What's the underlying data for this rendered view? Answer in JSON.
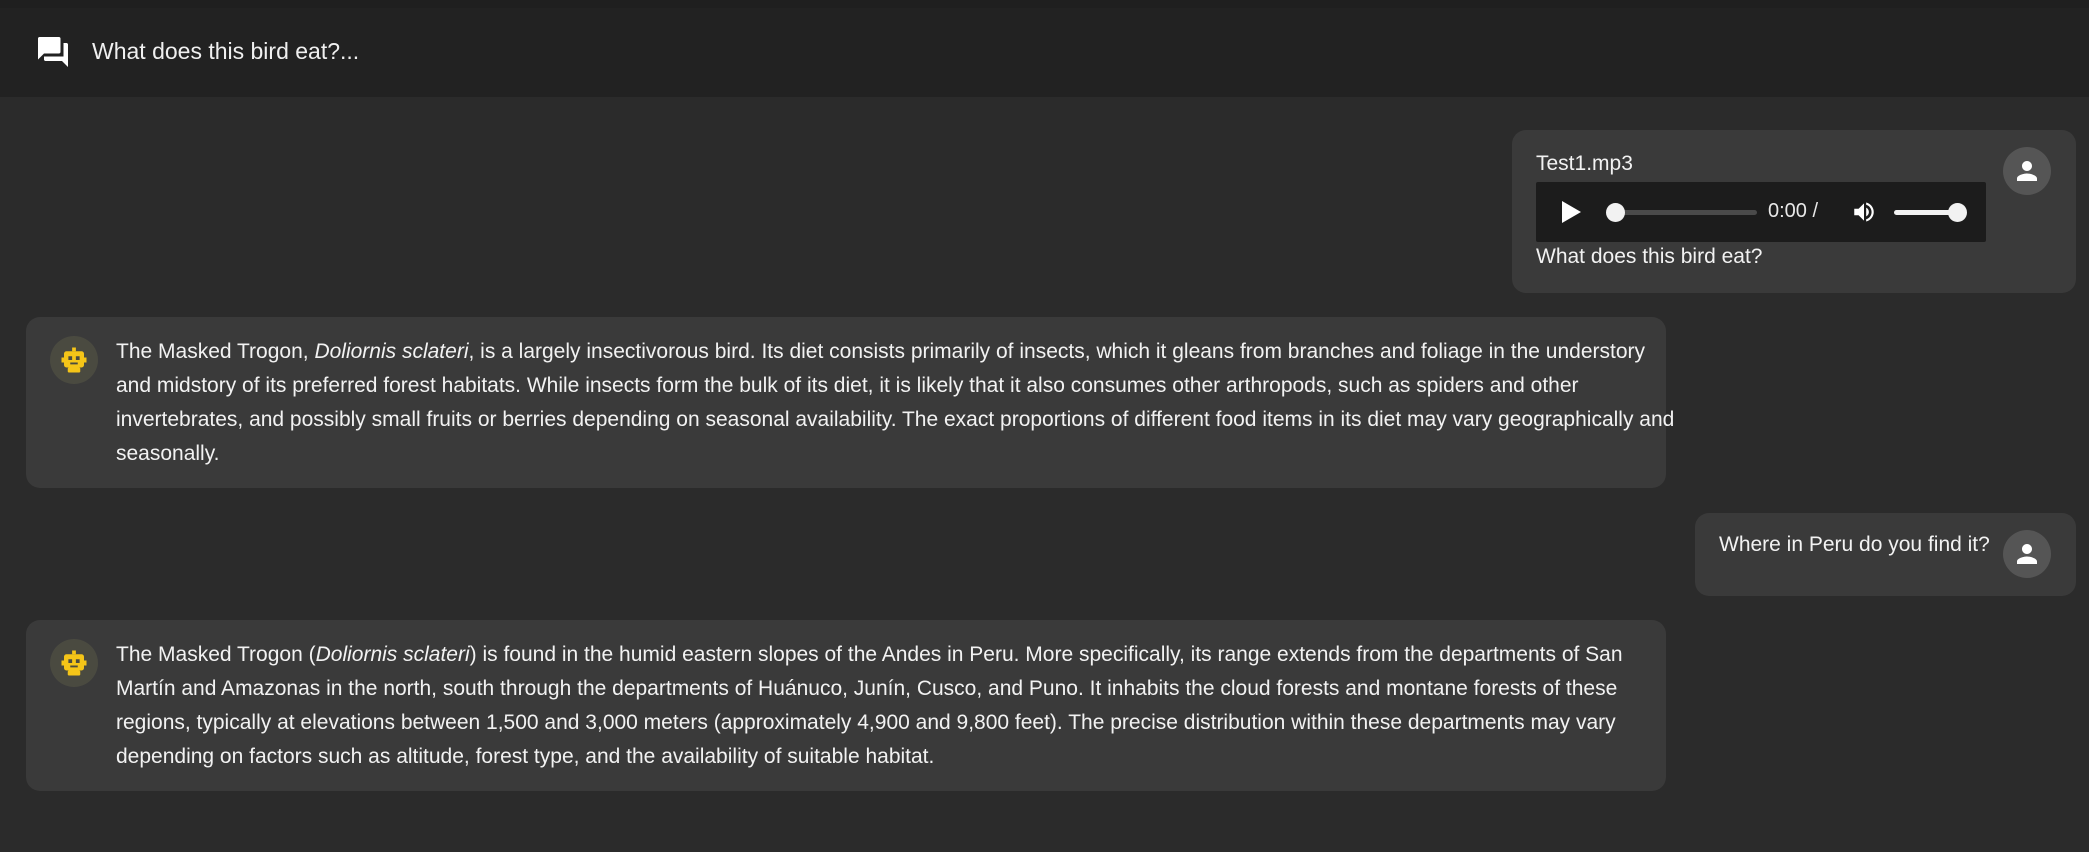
{
  "header": {
    "title": "What does this bird eat?...",
    "icon": "chat-bubbles-icon"
  },
  "messages": [
    {
      "role": "user",
      "attachment": {
        "filename": "Test1.mp3",
        "time": "0:00 /",
        "progress": 0.0,
        "volume": 1.0
      },
      "text": "What does this bird eat?"
    },
    {
      "role": "assistant",
      "parts": [
        "The Masked Trogon, ",
        "Doliornis sclateri",
        ", is a largely insectivorous bird. Its diet consists primarily of insects, which it gleans from branches and foliage in the understory and midstory of its preferred forest habitats. While insects form the bulk of its diet, it is likely that it also consumes other arthropods, such as spiders and other invertebrates, and possibly small fruits or berries depending on seasonal availability. The exact proportions of different food items in its diet may vary geographically and seasonally."
      ]
    },
    {
      "role": "user",
      "text": "Where in Peru do you find it?"
    },
    {
      "role": "assistant",
      "parts": [
        "The Masked Trogon (",
        "Doliornis sclateri",
        ") is found in the humid eastern slopes of the Andes in Peru. More specifically, its range extends from the departments of San Martín and Amazonas in the north, south through the departments of Huánuco, Junín, Cusco, and Puno. It inhabits the cloud forests and montane forests of these regions, typically at elevations between 1,500 and 3,000 meters (approximately 4,900 and 9,800 feet). The precise distribution within these departments may vary depending on factors such as altitude, forest type, and the availability of suitable habitat."
      ]
    }
  ],
  "colors": {
    "background": "#2b2b2b",
    "header": "#222222",
    "bubble": "#3a3a3a",
    "bot_icon": "#f5c518",
    "user_avatar": "#555555"
  }
}
